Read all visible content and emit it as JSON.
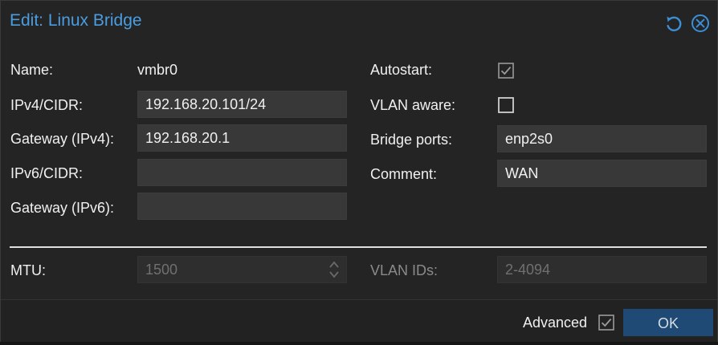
{
  "dialog": {
    "title": "Edit: Linux Bridge",
    "reset_icon": "reset-icon",
    "close_icon": "close-circle-icon"
  },
  "left": {
    "name_label": "Name:",
    "name_value": "vmbr0",
    "ipv4_label": "IPv4/CIDR:",
    "ipv4_value": "192.168.20.101/24",
    "gw4_label": "Gateway (IPv4):",
    "gw4_value": "192.168.20.1",
    "ipv6_label": "IPv6/CIDR:",
    "ipv6_value": "",
    "gw6_label": "Gateway (IPv6):",
    "gw6_value": ""
  },
  "right": {
    "autostart_label": "Autostart:",
    "autostart_checked": true,
    "vlan_aware_label": "VLAN aware:",
    "vlan_aware_checked": false,
    "bridge_ports_label": "Bridge ports:",
    "bridge_ports_value": "enp2s0",
    "comment_label": "Comment:",
    "comment_value": "WAN"
  },
  "advanced": {
    "mtu_label": "MTU:",
    "mtu_placeholder": "1500",
    "vlan_ids_label": "VLAN IDs:",
    "vlan_ids_placeholder": "2-4094"
  },
  "footer": {
    "advanced_label": "Advanced",
    "advanced_checked": true,
    "ok_label": "OK"
  },
  "colors": {
    "title": "#4a9de0",
    "ok_button": "#1e4a75",
    "background": "#242424"
  }
}
